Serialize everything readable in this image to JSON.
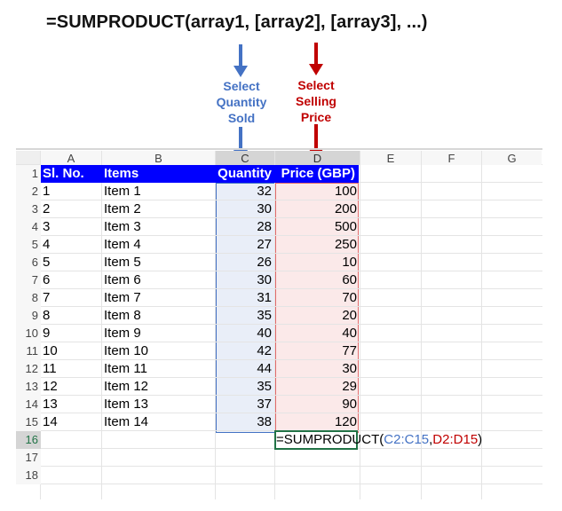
{
  "title_formula": "=SUMPRODUCT(array1, [array2], [array3], ...)",
  "notes": {
    "quantity": [
      "Select",
      "Quantity",
      "Sold"
    ],
    "price": [
      "Select",
      "Selling",
      "Price"
    ]
  },
  "colors": {
    "header_fill": "#0000ff",
    "quantity_accent": "#4472c4",
    "price_accent": "#c00000",
    "active_border": "#217346"
  },
  "sheet": {
    "columns": [
      "A",
      "B",
      "C",
      "D",
      "E",
      "F",
      "G"
    ],
    "row_numbers": [
      "1",
      "2",
      "3",
      "4",
      "5",
      "6",
      "7",
      "8",
      "9",
      "10",
      "11",
      "12",
      "13",
      "14",
      "15",
      "16",
      "17",
      "18"
    ],
    "header": {
      "a": "Sl. No.",
      "b": "Items",
      "c": "Quantity",
      "d": "Price (GBP)"
    },
    "rows": [
      {
        "a": "1",
        "b": "Item 1",
        "c": "32",
        "d": "100"
      },
      {
        "a": "2",
        "b": "Item 2",
        "c": "30",
        "d": "200"
      },
      {
        "a": "3",
        "b": "Item 3",
        "c": "28",
        "d": "500"
      },
      {
        "a": "4",
        "b": "Item 4",
        "c": "27",
        "d": "250"
      },
      {
        "a": "5",
        "b": "Item 5",
        "c": "26",
        "d": "10"
      },
      {
        "a": "6",
        "b": "Item 6",
        "c": "30",
        "d": "60"
      },
      {
        "a": "7",
        "b": "Item 7",
        "c": "31",
        "d": "70"
      },
      {
        "a": "8",
        "b": "Item 8",
        "c": "35",
        "d": "20"
      },
      {
        "a": "9",
        "b": "Item 9",
        "c": "40",
        "d": "40"
      },
      {
        "a": "10",
        "b": "Item 10",
        "c": "42",
        "d": "77"
      },
      {
        "a": "11",
        "b": "Item 11",
        "c": "44",
        "d": "30"
      },
      {
        "a": "12",
        "b": "Item 12",
        "c": "35",
        "d": "29"
      },
      {
        "a": "13",
        "b": "Item 13",
        "c": "37",
        "d": "90"
      },
      {
        "a": "14",
        "b": "Item 14",
        "c": "38",
        "d": "120"
      }
    ],
    "formula_cell": {
      "prefix": "=SUMPRODUCT(",
      "ref1": "C2:C15",
      "sep": ",",
      "ref2": "D2:D15",
      "suffix": ")"
    }
  }
}
